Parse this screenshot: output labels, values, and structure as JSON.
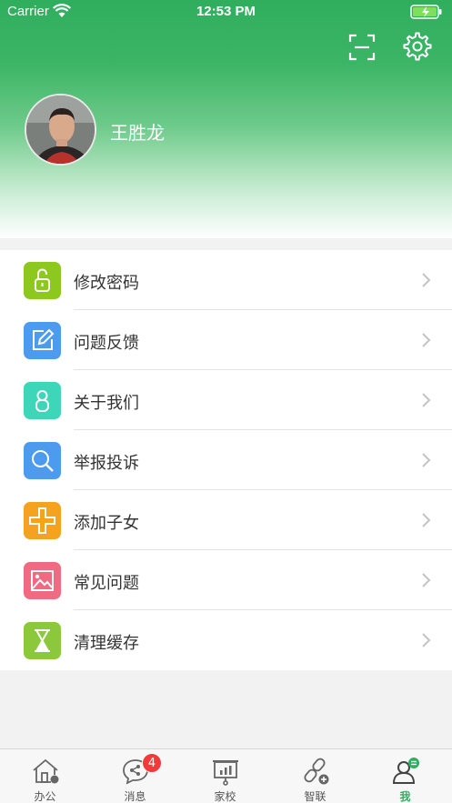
{
  "status_bar": {
    "carrier": "Carrier",
    "time": "12:53 PM"
  },
  "header": {
    "username": "王胜龙"
  },
  "menu": {
    "items": [
      {
        "label": "修改密码",
        "icon": "unlock-icon",
        "color": "#8cc81e"
      },
      {
        "label": "问题反馈",
        "icon": "edit-icon",
        "color": "#4d9bef"
      },
      {
        "label": "关于我们",
        "icon": "person-icon",
        "color": "#3ed6b8"
      },
      {
        "label": "举报投诉",
        "icon": "search-icon",
        "color": "#4d9bef"
      },
      {
        "label": "添加子女",
        "icon": "plus-icon",
        "color": "#f5a31e"
      },
      {
        "label": "常见问题",
        "icon": "image-icon",
        "color": "#f06a82"
      },
      {
        "label": "清理缓存",
        "icon": "hourglass-icon",
        "color": "#8cc83c"
      }
    ]
  },
  "tabbar": {
    "tabs": [
      {
        "label": "办公",
        "icon": "home-icon"
      },
      {
        "label": "消息",
        "icon": "chat-icon",
        "badge": "4"
      },
      {
        "label": "家校",
        "icon": "board-icon"
      },
      {
        "label": "智联",
        "icon": "link-icon"
      },
      {
        "label": "我",
        "icon": "profile-icon",
        "active": true
      }
    ]
  },
  "colors": {
    "brand_green": "#2fae5e",
    "badge_red": "#f23a3a"
  }
}
